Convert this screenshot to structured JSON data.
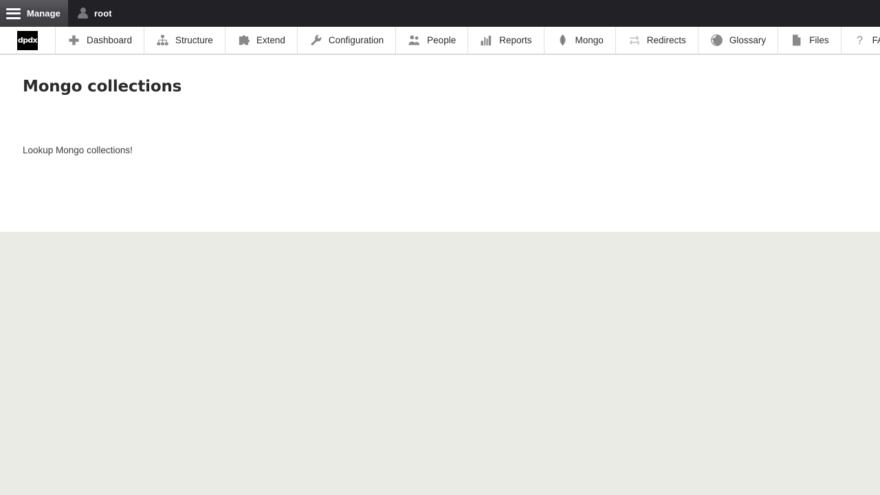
{
  "admin_bar": {
    "manage": {
      "label": "Manage",
      "icon": "hamburger-menu-icon"
    },
    "user": {
      "label": "root",
      "icon": "user-account-icon"
    }
  },
  "toolbar": {
    "logo_text": "dpdx",
    "items": [
      {
        "label": "Dashboard",
        "icon": "plus-icon"
      },
      {
        "label": "Structure",
        "icon": "hierarchy-icon"
      },
      {
        "label": "Extend",
        "icon": "puzzle-piece-icon"
      },
      {
        "label": "Configuration",
        "icon": "wrench-icon"
      },
      {
        "label": "People",
        "icon": "people-icon"
      },
      {
        "label": "Reports",
        "icon": "bar-chart-icon"
      },
      {
        "label": "Mongo",
        "icon": "mongodb-leaf-icon"
      },
      {
        "label": "Redirects",
        "icon": "swap-arrows-icon"
      },
      {
        "label": "Glossary",
        "icon": "globe-icon"
      },
      {
        "label": "Files",
        "icon": "document-icon"
      },
      {
        "label": "FAQ",
        "icon": "question-mark-icon"
      }
    ],
    "collapse": {
      "icon": "collapse-left-icon",
      "label": ""
    }
  },
  "main": {
    "title": "Mongo collections",
    "body_text": "Lookup Mongo collections!"
  },
  "colors": {
    "admin_bar_bg": "#222226",
    "manage_tab_bg": "#47474b",
    "toolbar_bg": "#ffffff",
    "content_bg": "#ffffff",
    "page_bg": "#ebebe6",
    "icon_gray": "#898989",
    "text_dark": "#2b2b2b"
  }
}
